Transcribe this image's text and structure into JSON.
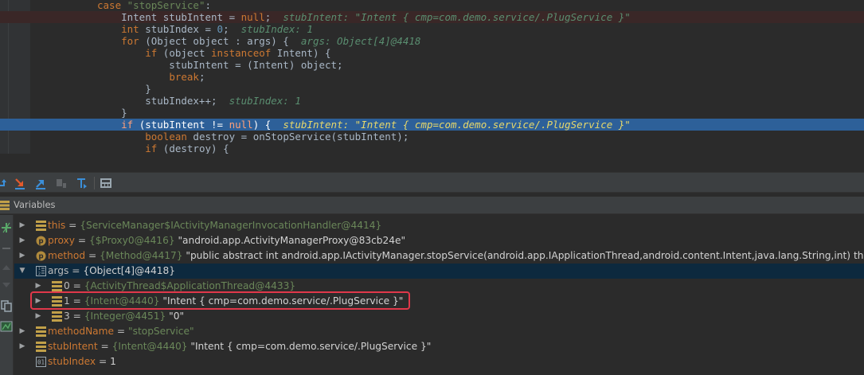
{
  "editor": {
    "lines": [
      {
        "code_html": "    <span class=\"kw\">case</span> <span class=\"str\">\"stopService\"</span>:",
        "state": ""
      },
      {
        "code_html": "        Intent stubIntent = <span class=\"kw\">null</span>;  <span class=\"inl\">stubIntent: \"Intent { cmp=com.demo.service/.PlugService }\"</span>",
        "state": "err"
      },
      {
        "code_html": "        <span class=\"kw\">int</span> stubIndex = <span class=\"num\">0</span>;  <span class=\"inl\">stubIndex: 1</span>",
        "state": ""
      },
      {
        "code_html": "        <span class=\"kw\">for</span> (Object object : args) {  <span class=\"inl\">args: Object[4]@4418</span>",
        "state": ""
      },
      {
        "code_html": "            <span class=\"kw\">if</span> (object <span class=\"kw\">instanceof</span> Intent) {",
        "state": ""
      },
      {
        "code_html": "                stubIntent = (Intent) object;",
        "state": ""
      },
      {
        "code_html": "                <span class=\"kw\">break</span>;",
        "state": ""
      },
      {
        "code_html": "            }",
        "state": ""
      },
      {
        "code_html": "            stubIndex++;  <span class=\"inl\">stubIndex: 1</span>",
        "state": ""
      },
      {
        "code_html": "        }",
        "state": ""
      },
      {
        "code_html": "        <span class=\"kw\">if</span> (stubIntent != <span class=\"kw\">null</span>) {  <span class=\"inl\">stubIntent: \"Intent { cmp=com.demo.service/.PlugService }\"</span>",
        "state": "cur"
      },
      {
        "code_html": "            <span class=\"kw\">boolean</span> destroy = onStopService(stubIntent);",
        "state": ""
      },
      {
        "code_html": "            <span class=\"kw\">if</span> (destroy) {",
        "state": ""
      }
    ]
  },
  "toolbar": {
    "icons": [
      "step-over-icon",
      "step-into-icon",
      "force-step-into-icon",
      "step-out-icon",
      "run-to-cursor-icon",
      "evaluate-expression-icon"
    ]
  },
  "variables": {
    "title": "Variables",
    "rows": [
      {
        "name": "this",
        "name_style": "field",
        "sep": " = ",
        "type": "{ServiceManager$IActivityManagerInvocationHandler@4414}",
        "value": "",
        "indent": 0,
        "arrow": "▶",
        "icon": "field-icon"
      },
      {
        "name": "proxy",
        "name_style": "field",
        "sep": " = ",
        "type": "{$Proxy0@4416}",
        "value": " \"android.app.ActivityManagerProxy@83cb24e\"",
        "indent": 0,
        "arrow": "▶",
        "icon": "parameter-icon"
      },
      {
        "name": "method",
        "name_style": "field",
        "sep": " = ",
        "type": "{Method@4417}",
        "value": " \"public abstract int android.app.IActivityManager.stopService(android.app.IApplicationThread,android.content.Intent,java.lang.String,int) th",
        "indent": 0,
        "arrow": "▶",
        "icon": "parameter-icon"
      },
      {
        "name": "args",
        "name_style": "plain",
        "sep": " = ",
        "type": "",
        "value": "{Object[4]@4418}",
        "indent": 0,
        "arrow": "▼",
        "icon": "array-icon",
        "selected": true
      },
      {
        "name": "0",
        "name_style": "plain",
        "sep": " = ",
        "type": "{ActivityThread$ApplicationThread@4433}",
        "value": "",
        "indent": 1,
        "arrow": "▶",
        "icon": "field-icon"
      },
      {
        "name": "1",
        "name_style": "plain",
        "sep": " = ",
        "type": "{Intent@4440}",
        "value": " \"Intent { cmp=com.demo.service/.PlugService }\"",
        "indent": 1,
        "arrow": "▶",
        "icon": "field-icon"
      },
      {
        "name": "3",
        "name_style": "plain",
        "sep": " = ",
        "type": "{Integer@4451}",
        "value": " \"0\"",
        "indent": 1,
        "arrow": "▶",
        "icon": "field-icon"
      },
      {
        "name": "methodName",
        "name_style": "field",
        "sep": " = ",
        "type": "",
        "value": "\"stopService\"",
        "value_style": "str",
        "indent": 0,
        "arrow": "▶",
        "icon": "field-icon"
      },
      {
        "name": "stubIntent",
        "name_style": "field",
        "sep": " = ",
        "type": "{Intent@4440}",
        "value": " \"Intent { cmp=com.demo.service/.PlugService }\"",
        "indent": 0,
        "arrow": "▶",
        "icon": "field-icon"
      },
      {
        "name": "stubIndex",
        "name_style": "field",
        "sep": " = ",
        "type": "",
        "value": "1",
        "indent": 0,
        "arrow": "",
        "icon": "primitive-icon"
      }
    ]
  },
  "colors": {
    "highlight_box": "#e0384a",
    "current_line": "#2d6099",
    "selected_row": "#0d293e"
  }
}
